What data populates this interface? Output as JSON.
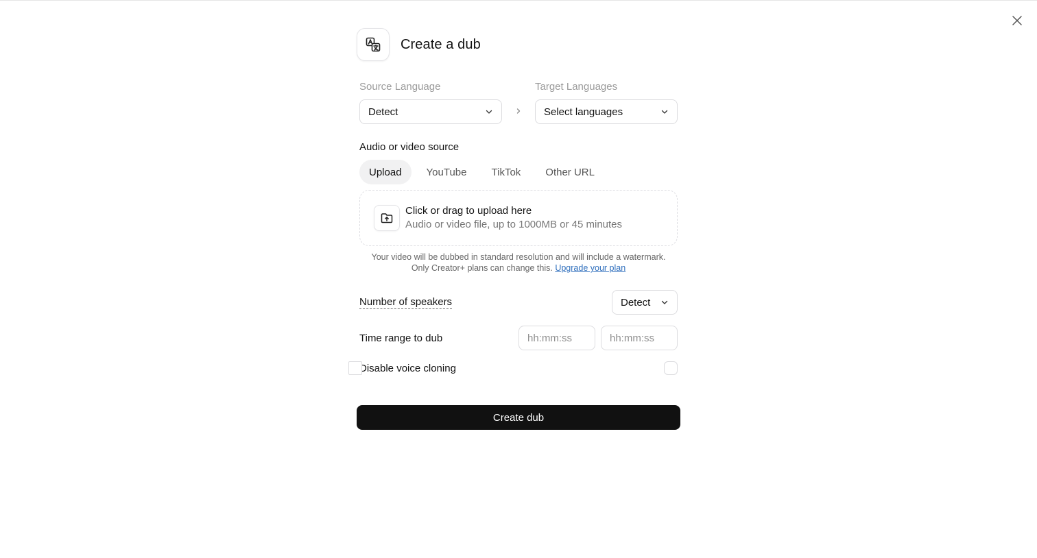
{
  "dialog": {
    "title": "Create a dub",
    "header_icon": "translate-icon",
    "close_icon": "close-icon"
  },
  "languages": {
    "source_label": "Source Language",
    "source_value": "Detect",
    "target_label": "Target Languages",
    "target_value": "Select languages"
  },
  "source": {
    "label": "Audio or video source",
    "tabs": [
      {
        "label": "Upload",
        "active": true
      },
      {
        "label": "YouTube",
        "active": false
      },
      {
        "label": "TikTok",
        "active": false
      },
      {
        "label": "Other URL",
        "active": false
      }
    ],
    "upload_title": "Click or drag to upload here",
    "upload_subtitle": "Audio or video file, up to 1000MB or 45 minutes",
    "upload_icon": "folder-upload-icon"
  },
  "notice": {
    "line1": "Your video will be dubbed in standard resolution and will include a watermark.",
    "line2": "Only Creator+ plans can change this.",
    "link": "Upgrade your plan"
  },
  "speakers": {
    "label": "Number of speakers",
    "value": "Detect"
  },
  "time_range": {
    "label": "Time range to dub",
    "start_placeholder": "hh:mm:ss",
    "end_placeholder": "hh:mm:ss"
  },
  "voice_cloning": {
    "label": "Disable voice cloning",
    "checked": false
  },
  "actions": {
    "create_label": "Create dub"
  },
  "colors": {
    "primary_button": "#111111",
    "link": "#2f6fbd",
    "border": "#dcdcdf",
    "muted_text": "#9a9a9a"
  }
}
